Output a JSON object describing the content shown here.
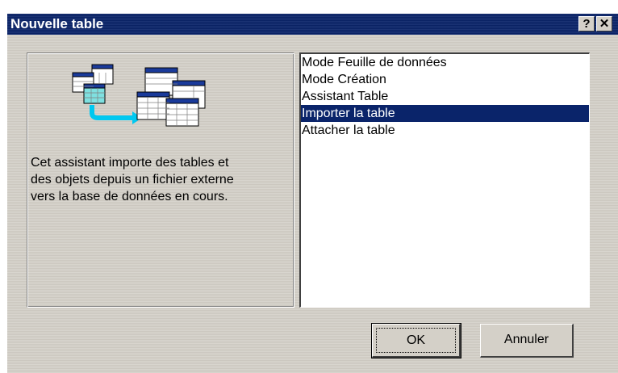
{
  "window": {
    "title": "Nouvelle table",
    "help_label": "?",
    "close_label": "✕"
  },
  "left_panel": {
    "illustration_icon": "import-table-wizard-icon",
    "description_lines": [
      "Cet assistant importe des tables et",
      "des objets depuis un fichier externe",
      "vers la base de données en cours."
    ]
  },
  "list": {
    "items": [
      "Mode Feuille de données",
      "Mode Création",
      "Assistant Table",
      "Importer la table",
      "Attacher la table"
    ],
    "selected": "Importer la table"
  },
  "buttons": {
    "ok": "OK",
    "cancel": "Annuler"
  },
  "colors": {
    "titlebar": "#0a246a",
    "selection": "#0a246a",
    "face": "#d4d0c8",
    "accent_arrow": "#00c8f0"
  }
}
